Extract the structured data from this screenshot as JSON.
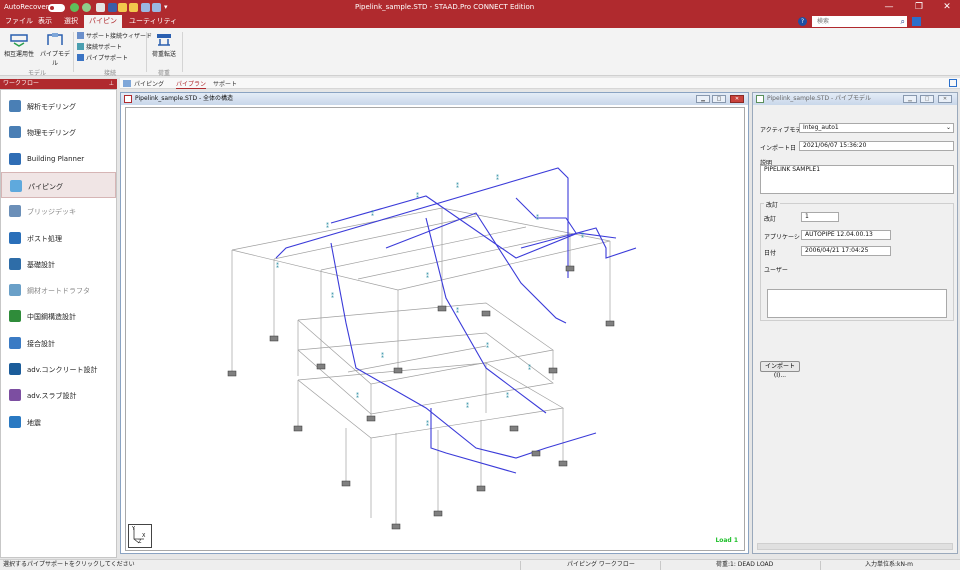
{
  "titlebar": {
    "autorecovery": "AutoRecovery",
    "title": "Pipelink_sample.STD - STAAD.Pro CONNECT Edition",
    "minimize": "—",
    "restore": "❐",
    "close": "✕"
  },
  "menu": {
    "tabs": [
      "ファイル",
      "表示",
      "選択",
      "パイピング",
      "ユーティリティ"
    ],
    "active_index": 3,
    "search_placeholder": "検索",
    "help_icon": "?"
  },
  "ribbon": {
    "interop_label": "相互運用性",
    "pipe_model_label": "パイプモデル",
    "group_model": "モデル",
    "support_wizard": "サポート接続ウィザード",
    "connect_support": "接続サポート",
    "pipe_support": "パイプサポート",
    "group_connect": "接続",
    "load_transfer": "荷重転送",
    "group_load": "荷重"
  },
  "workflow": {
    "header": "ワークフロー",
    "pin": "📌",
    "items": [
      {
        "label": "解析モデリング",
        "color": "#4a7fb5",
        "dim": false
      },
      {
        "label": "物理モデリング",
        "color": "#4a7fb5",
        "dim": false
      },
      {
        "label": "Building Planner",
        "color": "#2f6db5",
        "dim": false
      },
      {
        "label": "パイピング",
        "color": "#5fa9dd",
        "dim": false
      },
      {
        "label": "ブリッジデッキ",
        "color": "#6b8fb8",
        "dim": true
      },
      {
        "label": "ポスト処理",
        "color": "#2a6fb9",
        "dim": false
      },
      {
        "label": "基礎設計",
        "color": "#2e6da8",
        "dim": false
      },
      {
        "label": "鋼材オートドラフタ",
        "color": "#6aa0c8",
        "dim": true
      },
      {
        "label": "中国鋼構造設計",
        "color": "#2f8c3a",
        "dim": false
      },
      {
        "label": "接合設計",
        "color": "#3b7bc4",
        "dim": false
      },
      {
        "label": "adv.コンクリート設計",
        "color": "#1b5c9a",
        "dim": false
      },
      {
        "label": "adv.スラブ設計",
        "color": "#7c4ea1",
        "dim": false
      },
      {
        "label": "地震",
        "color": "#2a79c2",
        "dim": false
      }
    ],
    "selected_index": 3
  },
  "subtabs": {
    "items": [
      "パイピング",
      "パイプラン",
      "サポート"
    ],
    "active_index": 1
  },
  "viewport": {
    "title": "Pipelink_sample.STD - 全体の構造",
    "load_label": "Load 1",
    "axis_y": "Y",
    "axis_x": "X",
    "axis_z": "Z"
  },
  "properties": {
    "title": "Pipelink_sample.STD - パイプモデル",
    "active_model_label": "アクティブモデ",
    "active_model_value": "Integ_auto1",
    "import_date_label": "インポート日",
    "import_date_value": "2021/06/07 15:36:20",
    "description_label": "説明",
    "description_value": "PIPELINK SAMPLE1",
    "revision_group": "改訂",
    "revision_label": "改訂",
    "revision_value": "1",
    "application_label": "アプリケーショ",
    "application_value": "AUTOPIPE 12.04.00.13",
    "date_label": "日付",
    "date_value": "2006/04/21 17:04:25",
    "user_label": "ユーザー",
    "user_value": "",
    "import_button": "インポート(I)...",
    "dropdown_icon": "chevron-down-icon"
  },
  "statusbar": {
    "left": "選択するパイプサポートをクリックしてください",
    "workflow": "パイピング ワークフロー",
    "load": "荷重:1: DEAD LOAD",
    "units": "入力単位系:kN-m"
  },
  "colors": {
    "brand": "#b02a2e",
    "pipe": "#3b3bd9",
    "frame": "#9a9a9a",
    "support": "#2d8fa3",
    "load_green": "#1ec02a"
  }
}
